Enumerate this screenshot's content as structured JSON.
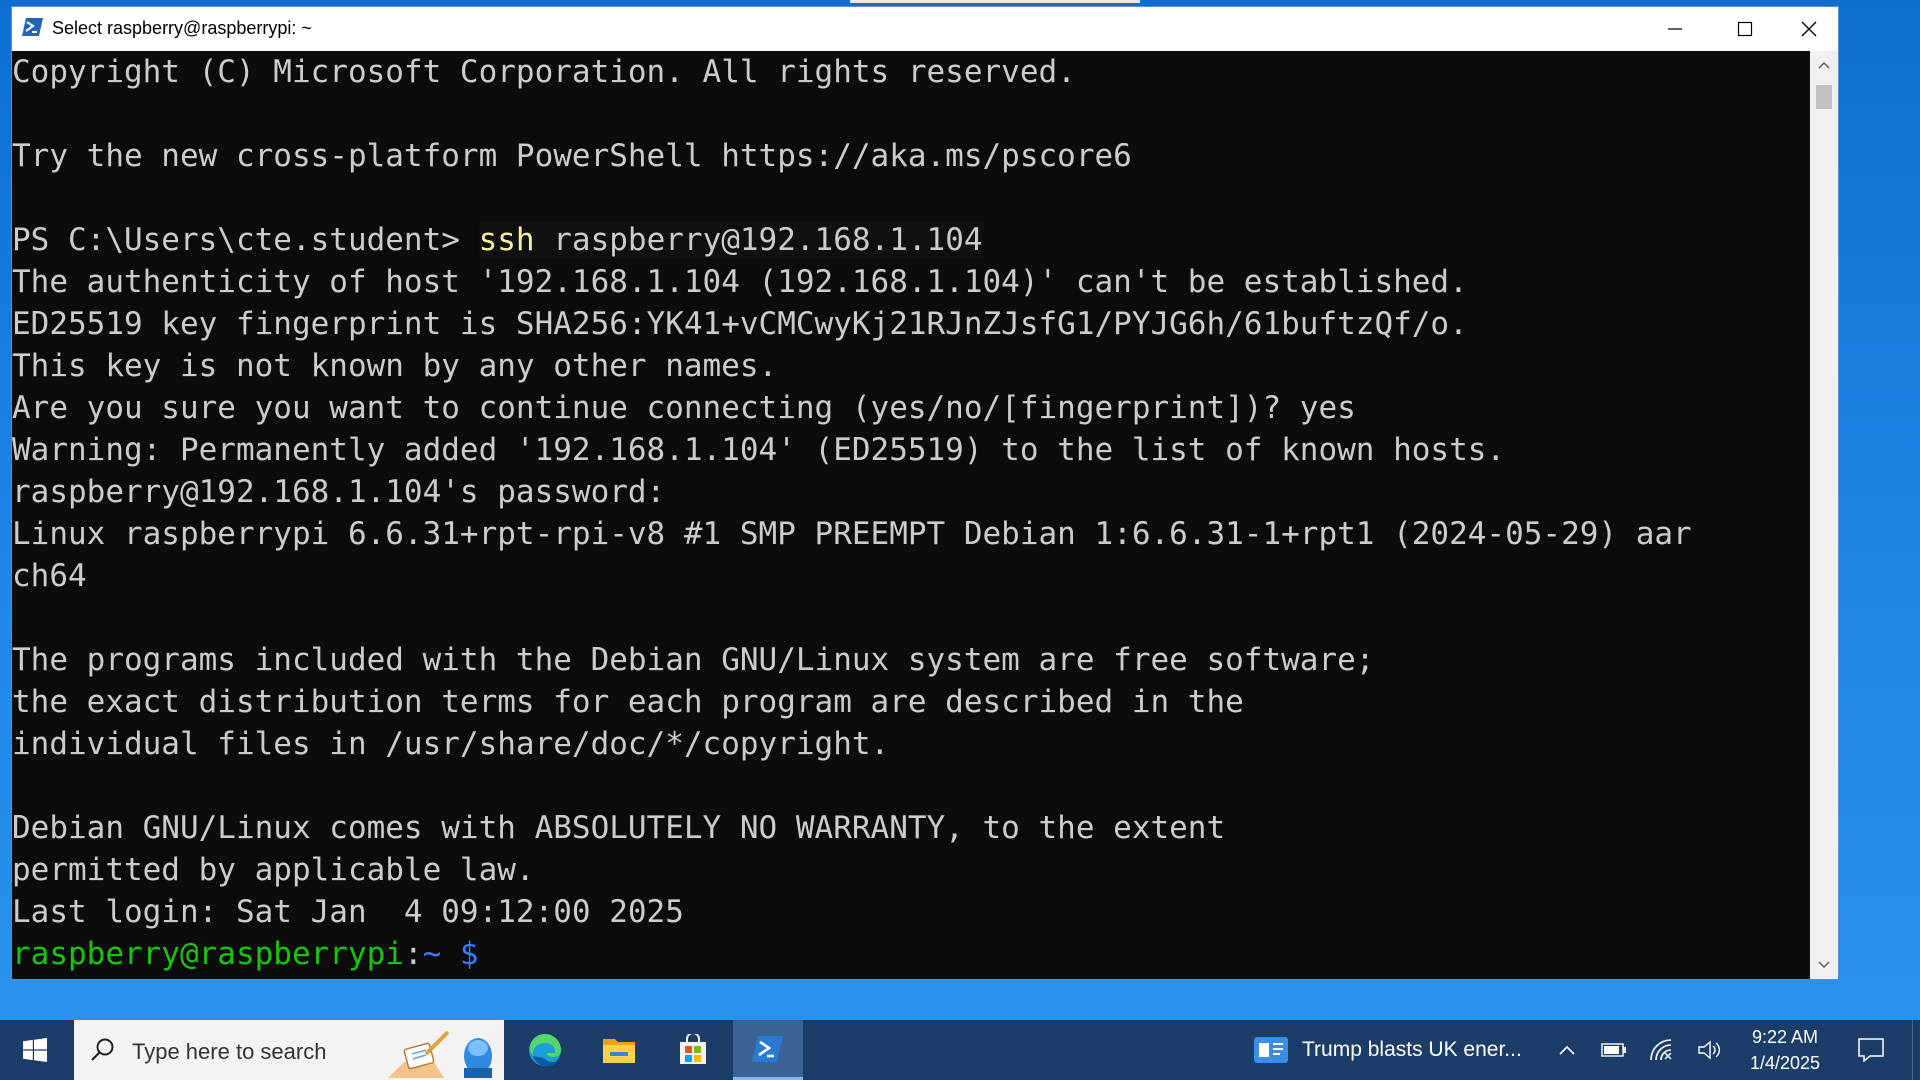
{
  "window": {
    "title": "Select raspberry@raspberrypi: ~"
  },
  "terminal": {
    "lines": [
      "Copyright (C) Microsoft Corporation. All rights reserved.",
      "",
      "Try the new cross-platform PowerShell https://aka.ms/pscore6",
      "",
      {
        "prompt": "PS C:\\Users\\cte.student> ",
        "command": "ssh",
        "argument": " raspberry@192.168.1.104"
      },
      "The authenticity of host '192.168.1.104 (192.168.1.104)' can't be established.",
      "ED25519 key fingerprint is SHA256:YK41+vCMCwyKj21RJnZJsfG1/PYJG6h/61buftzQf/o.",
      "This key is not known by any other names.",
      "Are you sure you want to continue connecting (yes/no/[fingerprint])? yes",
      "Warning: Permanently added '192.168.1.104' (ED25519) to the list of known hosts.",
      "raspberry@192.168.1.104's password:",
      "Linux raspberrypi 6.6.31+rpt-rpi-v8 #1 SMP PREEMPT Debian 1:6.6.31-1+rpt1 (2024-05-29) aar",
      "ch64",
      "",
      "The programs included with the Debian GNU/Linux system are free software;",
      "the exact distribution terms for each program are described in the",
      "individual files in /usr/share/doc/*/copyright.",
      "",
      "Debian GNU/Linux comes with ABSOLUTELY NO WARRANTY, to the extent",
      "permitted by applicable law.",
      "Last login: Sat Jan  4 09:12:00 2025",
      {
        "user_host": "raspberry@raspberrypi",
        "sep": ":",
        "path": "~ $",
        "cursor": ""
      }
    ],
    "colors": {
      "background": "#0c0c0c",
      "text": "#cccccc",
      "command": "#f9f1a5",
      "prompt_user": "#16c60c",
      "prompt_path": "#3b78ff"
    }
  },
  "taskbar": {
    "search_placeholder": "Type here to search",
    "apps": [
      "edge-icon",
      "file-explorer-icon",
      "microsoft-store-icon",
      "powershell-icon"
    ],
    "news": "Trump blasts UK ener...",
    "time": "9:22 AM",
    "date": "1/4/2025"
  }
}
